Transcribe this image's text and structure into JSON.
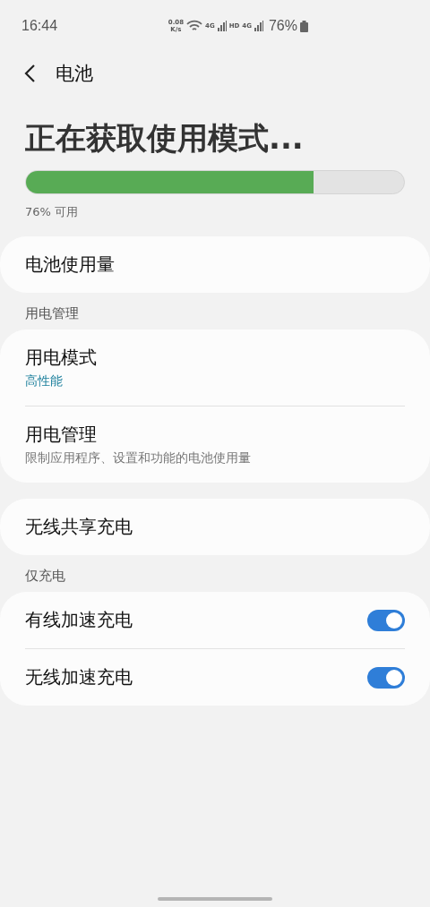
{
  "status_bar": {
    "time": "16:44",
    "speed": "0.08",
    "speed_unit": "K/s",
    "network_labels": [
      "4G",
      "HD",
      "4G"
    ],
    "battery": "76%"
  },
  "header": {
    "title": "电池"
  },
  "usage": {
    "title": "正在获取使用模式...",
    "level": 0.76,
    "caption": "76% 可用"
  },
  "groups": [
    {
      "items": [
        {
          "kind": "plain",
          "title": "电池使用量"
        }
      ]
    },
    {
      "header": "用电管理",
      "items": [
        {
          "kind": "value",
          "title": "用电模式",
          "subtitle": "高性能"
        },
        {
          "kind": "description",
          "title": "用电管理",
          "subtitle": "限制应用程序、设置和功能的电池使用量"
        }
      ]
    },
    {
      "items": [
        {
          "kind": "plain",
          "title": "无线共享充电"
        }
      ]
    },
    {
      "header": "仅充电",
      "items": [
        {
          "kind": "toggle",
          "title": "有线加速充电",
          "on": true
        },
        {
          "kind": "toggle",
          "title": "无线加速充电",
          "on": true
        }
      ]
    }
  ]
}
